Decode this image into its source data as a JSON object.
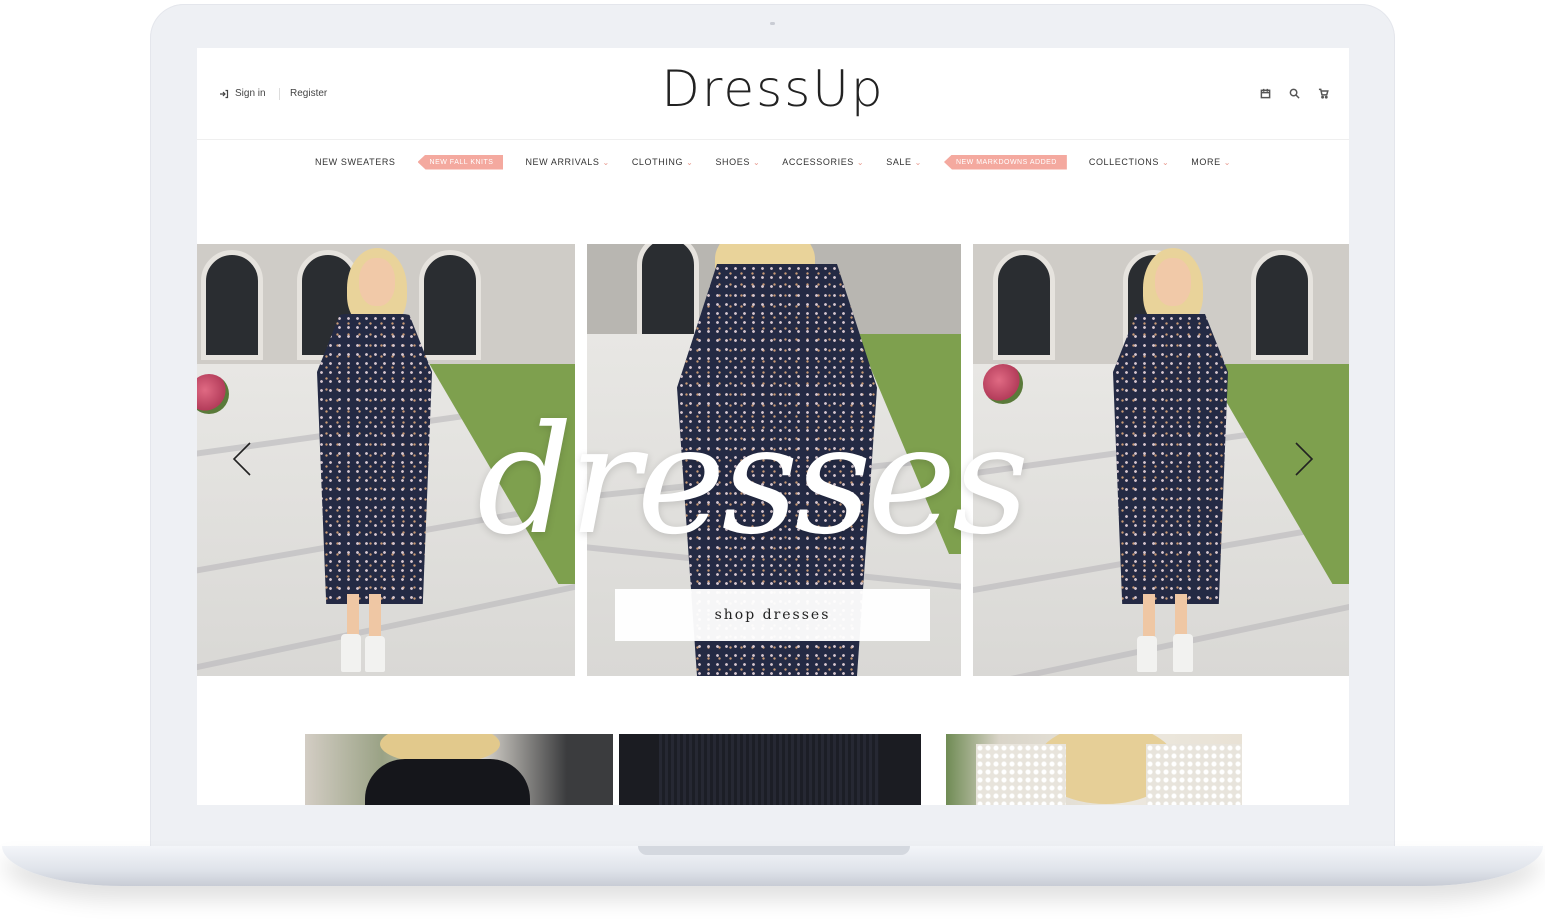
{
  "header": {
    "sign_in": "Sign in",
    "register": "Register",
    "logo": "DressUp"
  },
  "icons": [
    "user-icon",
    "calendar-icon",
    "search-icon",
    "cart-icon"
  ],
  "nav": {
    "items": [
      {
        "label": "NEW SWEATERS",
        "has_dropdown": false
      },
      {
        "label": "NEW FALL KNITS",
        "badge": true
      },
      {
        "label": "NEW ARRIVALS",
        "has_dropdown": true
      },
      {
        "label": "CLOTHING",
        "has_dropdown": true
      },
      {
        "label": "SHOES",
        "has_dropdown": true
      },
      {
        "label": "ACCESSORIES",
        "has_dropdown": true
      },
      {
        "label": "SALE",
        "has_dropdown": true
      },
      {
        "label": "NEW MARKDOWNS ADDED",
        "badge": true
      },
      {
        "label": "COLLECTIONS",
        "has_dropdown": true
      },
      {
        "label": "MORE",
        "has_dropdown": true
      }
    ],
    "chevron": "⌄"
  },
  "hero": {
    "script_title": "dresses",
    "cta": "shop dresses"
  },
  "colors": {
    "badge": "#f4a99f",
    "chevron": "#e89a8f",
    "frame": "#eef0f4"
  }
}
